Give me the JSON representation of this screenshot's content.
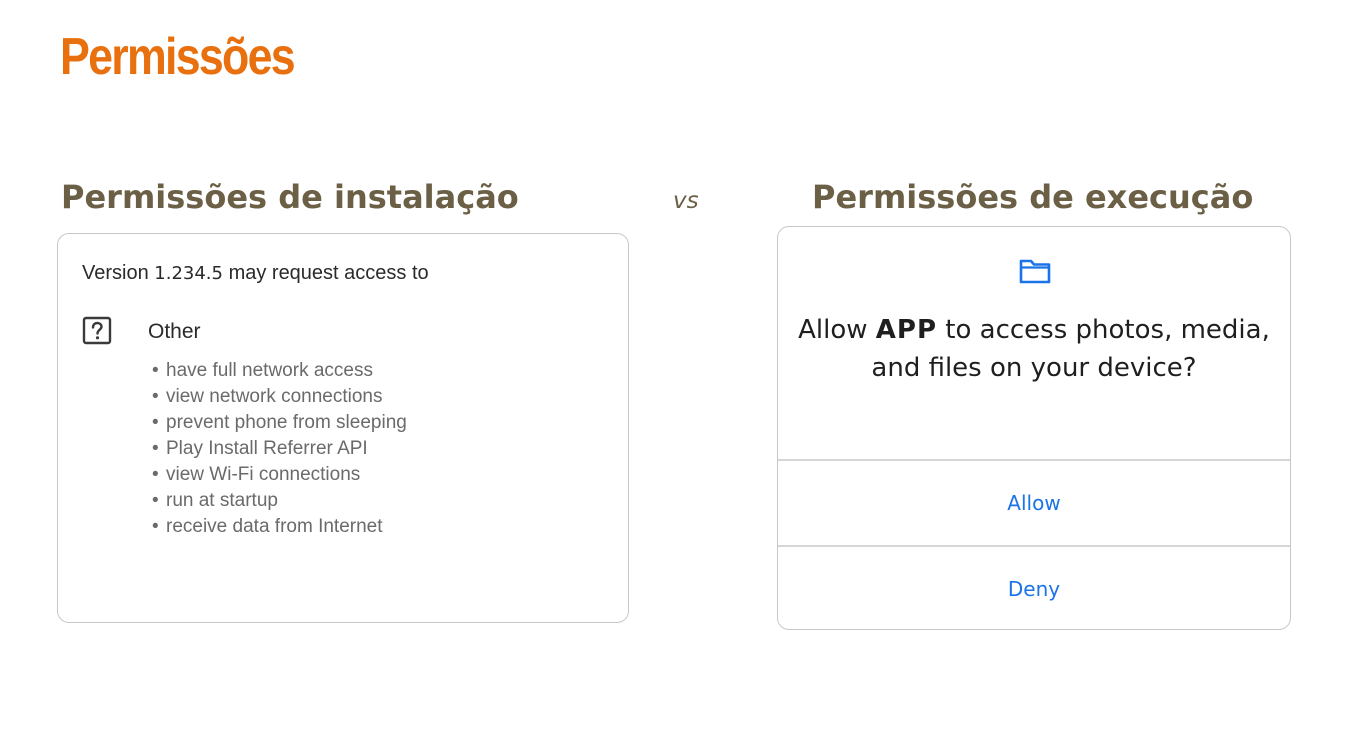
{
  "slide": {
    "title": "Permissões",
    "vs_label": "vs",
    "colors": {
      "title": "#e8700f",
      "heading": "#6b5f45",
      "link": "#1a73e8"
    }
  },
  "install": {
    "heading": "Permissões de instalação",
    "header_prefix": "Version",
    "version": "1.234.5",
    "header_suffix": "may request access to",
    "group_icon": "help-box-icon",
    "group_label": "Other",
    "permissions": [
      "have full network access",
      "view network connections",
      "prevent phone from sleeping",
      "Play Install Referrer API",
      "view Wi-Fi connections",
      "run at startup",
      "receive data from Internet"
    ]
  },
  "runtime": {
    "heading": "Permissões de execução",
    "icon": "folder-icon",
    "question_prefix": "Allow",
    "app_name": "APP",
    "question_suffix": "to access photos, media, and files on your device?",
    "allow_label": "Allow",
    "deny_label": "Deny"
  }
}
